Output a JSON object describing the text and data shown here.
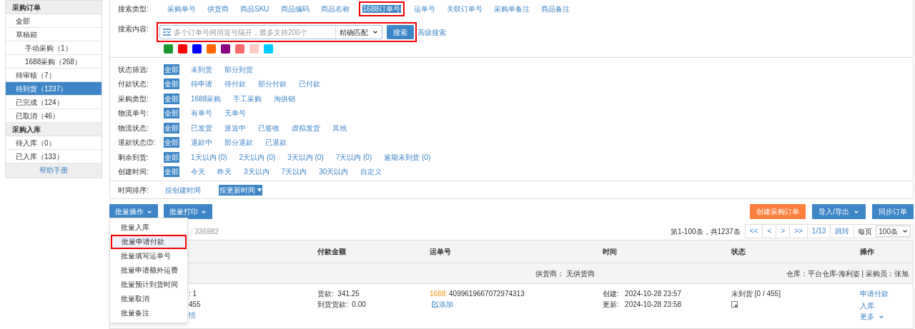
{
  "sidebar": {
    "sections": [
      {
        "title": "采购订单",
        "items": [
          {
            "label": "全部",
            "selected": false
          },
          {
            "label": "草稿箱",
            "selected": false,
            "children": [
              {
                "label": "手动采购（1）",
                "selected": false
              },
              {
                "label": "1688采购（268）",
                "selected": false
              }
            ]
          },
          {
            "label": "待审核（7）",
            "selected": false
          },
          {
            "label": "待到货（1237）",
            "selected": true
          },
          {
            "label": "已完成（124）",
            "selected": false
          },
          {
            "label": "已取消（46）",
            "selected": false
          }
        ]
      },
      {
        "title": "采购入库",
        "items": [
          {
            "label": "待入库（0）",
            "selected": false
          },
          {
            "label": "已入库（133）",
            "selected": false
          }
        ]
      }
    ],
    "help": "帮助手册"
  },
  "search": {
    "type_label": "搜索类型:",
    "types": [
      {
        "label": "采购单号",
        "selected": false
      },
      {
        "label": "供货商",
        "selected": false
      },
      {
        "label": "商品SKU",
        "selected": false
      },
      {
        "label": "商品编码",
        "selected": false
      },
      {
        "label": "商品名称",
        "selected": false
      },
      {
        "label": "1688订单号",
        "selected": true
      },
      {
        "label": "运单号",
        "selected": false
      },
      {
        "label": "关联订单号",
        "selected": false
      },
      {
        "label": "采购单备注",
        "selected": false
      },
      {
        "label": "商品备注",
        "selected": false
      }
    ],
    "content_label": "搜索内容:",
    "placeholder": "多个订单号间用逗号隔开，最多支持200个",
    "match": "精确匹配",
    "highlighted": true,
    "button": "搜索",
    "advanced": "高级搜索",
    "colors": [
      {
        "color": "#1a9a2e"
      },
      {
        "color": "#ff0000"
      },
      {
        "color": "#0000ff"
      },
      {
        "color": "#ff6600"
      },
      {
        "color": "#8b0080"
      },
      {
        "color": "#ff6b6b"
      },
      {
        "color": "#ffc9c4"
      },
      {
        "color": "#00ccff"
      }
    ]
  },
  "filters": [
    {
      "label": "状态筛选:",
      "kind": "plain",
      "options": [
        {
          "label": "全部",
          "selected": true
        },
        {
          "label": "未到货",
          "selected": false
        },
        {
          "label": "部分到货",
          "selected": false
        }
      ]
    },
    {
      "label": "付款状态:",
      "kind": "plain",
      "options": [
        {
          "label": "全部",
          "selected": true
        },
        {
          "label": "待申请",
          "selected": false
        },
        {
          "label": "待付款",
          "selected": false
        },
        {
          "label": "部分付款",
          "selected": false
        },
        {
          "label": "已付款",
          "selected": false
        }
      ]
    },
    {
      "label": "采购类型:",
      "kind": "plain",
      "options": [
        {
          "label": "全部",
          "selected": true
        },
        {
          "label": "1688采购",
          "selected": false
        },
        {
          "label": "手工采购",
          "selected": false
        },
        {
          "label": "淘供销",
          "selected": false
        }
      ]
    },
    {
      "label": "物流单号:",
      "kind": "plain",
      "options": [
        {
          "label": "全部",
          "selected": true
        },
        {
          "label": "有单号",
          "selected": false
        },
        {
          "label": "无单号",
          "selected": false
        }
      ]
    },
    {
      "label": "物流状态:",
      "kind": "plain",
      "options": [
        {
          "label": "全部",
          "selected": true
        },
        {
          "label": "已发货",
          "selected": false
        },
        {
          "label": "派送中",
          "selected": false
        },
        {
          "label": "已签收",
          "selected": false
        },
        {
          "label": "虚拟发货",
          "selected": false
        },
        {
          "label": "其他",
          "selected": false
        }
      ]
    },
    {
      "label": "退款状态",
      "kind": "with_help",
      "suffix": ":",
      "options": [
        {
          "label": "全部",
          "selected": true
        },
        {
          "label": "退款中",
          "selected": false
        },
        {
          "label": "部分退款",
          "selected": false
        },
        {
          "label": "已退款",
          "selected": false
        }
      ]
    },
    {
      "label": "剩余到货:",
      "kind": "plain",
      "options": [
        {
          "label": "全部",
          "selected": true
        },
        {
          "label": "1天以内 (0)",
          "selected": false
        },
        {
          "label": "2天以内 (0)",
          "selected": false
        },
        {
          "label": "3天以内 (0)",
          "selected": false
        },
        {
          "label": "7天以内 (0)",
          "selected": false
        },
        {
          "label": "逾期未到货 (0)",
          "selected": false
        }
      ]
    },
    {
      "label": "创建时间:",
      "kind": "plain",
      "options": [
        {
          "label": "全部",
          "selected": true
        },
        {
          "label": "今天",
          "selected": false
        },
        {
          "label": "昨天",
          "selected": false
        },
        {
          "label": "3天以内",
          "selected": false
        },
        {
          "label": "7天以内",
          "selected": false
        },
        {
          "label": "30天以内",
          "selected": false
        },
        {
          "label": "自定义",
          "selected": false
        }
      ]
    }
  ],
  "sort": {
    "label": "时间排序:",
    "options": [
      {
        "label": "按创建时间",
        "selected": false
      },
      {
        "label": "按更新时间",
        "selected": true
      }
    ]
  },
  "toolbar": {
    "left": [
      "批量操作",
      "批量打印"
    ],
    "right": [
      {
        "label": "创建采购订单",
        "kind": "primary",
        "menu": false
      },
      {
        "label": "导入/导出",
        "kind": "normal",
        "menu": true
      },
      {
        "label": "同步订单",
        "kind": "normal",
        "menu": false
      }
    ]
  },
  "batch_menu": [
    {
      "label": "批量入库",
      "selected": false
    },
    {
      "label": "批量申请付款",
      "selected": true
    },
    {
      "label": "批量填写运单号",
      "selected": false
    },
    {
      "label": "批量申请额外运费",
      "selected": false
    },
    {
      "label": "批量预计到货时间",
      "selected": false
    },
    {
      "label": "批量取消",
      "selected": false
    },
    {
      "label": "批量备注",
      "selected": false
    }
  ],
  "summary_partial": ": 336982",
  "pagination": {
    "summary": "第1-100条，共1237条",
    "buttons": [
      "<<",
      "<",
      ">",
      ">>",
      "1/13",
      "跳转"
    ],
    "per_page_label": "每页",
    "per_page": "100条"
  },
  "table": {
    "columns": [
      "付款金额",
      "运单号",
      "时间",
      "状态",
      "操作"
    ],
    "group": {
      "supplier": "供货商： 无供货商",
      "warehouse": "仓库：平台仓库-海利姿 | 采购员：张旭"
    },
    "row": {
      "item_lines": [
        ": 1",
        "455"
      ],
      "item_link": "情",
      "amount": [
        "货款:  341.25",
        "到货货款:  0.00"
      ],
      "waybill_prefix": "1688:",
      "waybill": "4099619667072974313",
      "waybill_add": "添加",
      "time": [
        "创建:   2024-10-28 23:57",
        "更新:   2024-10-28 23:58"
      ],
      "status": "未到货 [0 / 455]",
      "actions": [
        "申请付款",
        "入库",
        "更多"
      ]
    }
  }
}
